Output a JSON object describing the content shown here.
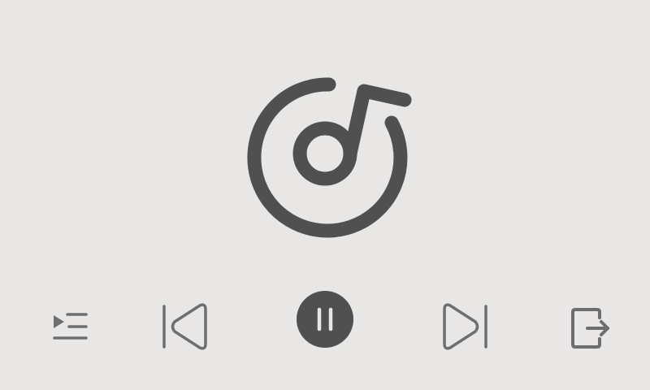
{
  "colors": {
    "background": "#E8E7E5",
    "icon_dark": "#505050",
    "icon_light": "#6E6E6E",
    "pause_glyph": "#E8E7E5"
  },
  "player": {
    "artwork_icon": "music-note-disc-icon",
    "state": "playing"
  },
  "controls": {
    "playlist": {
      "icon": "playlist-play-icon"
    },
    "previous": {
      "icon": "skip-previous-icon"
    },
    "pause": {
      "icon": "pause-icon"
    },
    "next": {
      "icon": "skip-next-icon"
    },
    "exit": {
      "icon": "exit-icon"
    }
  }
}
